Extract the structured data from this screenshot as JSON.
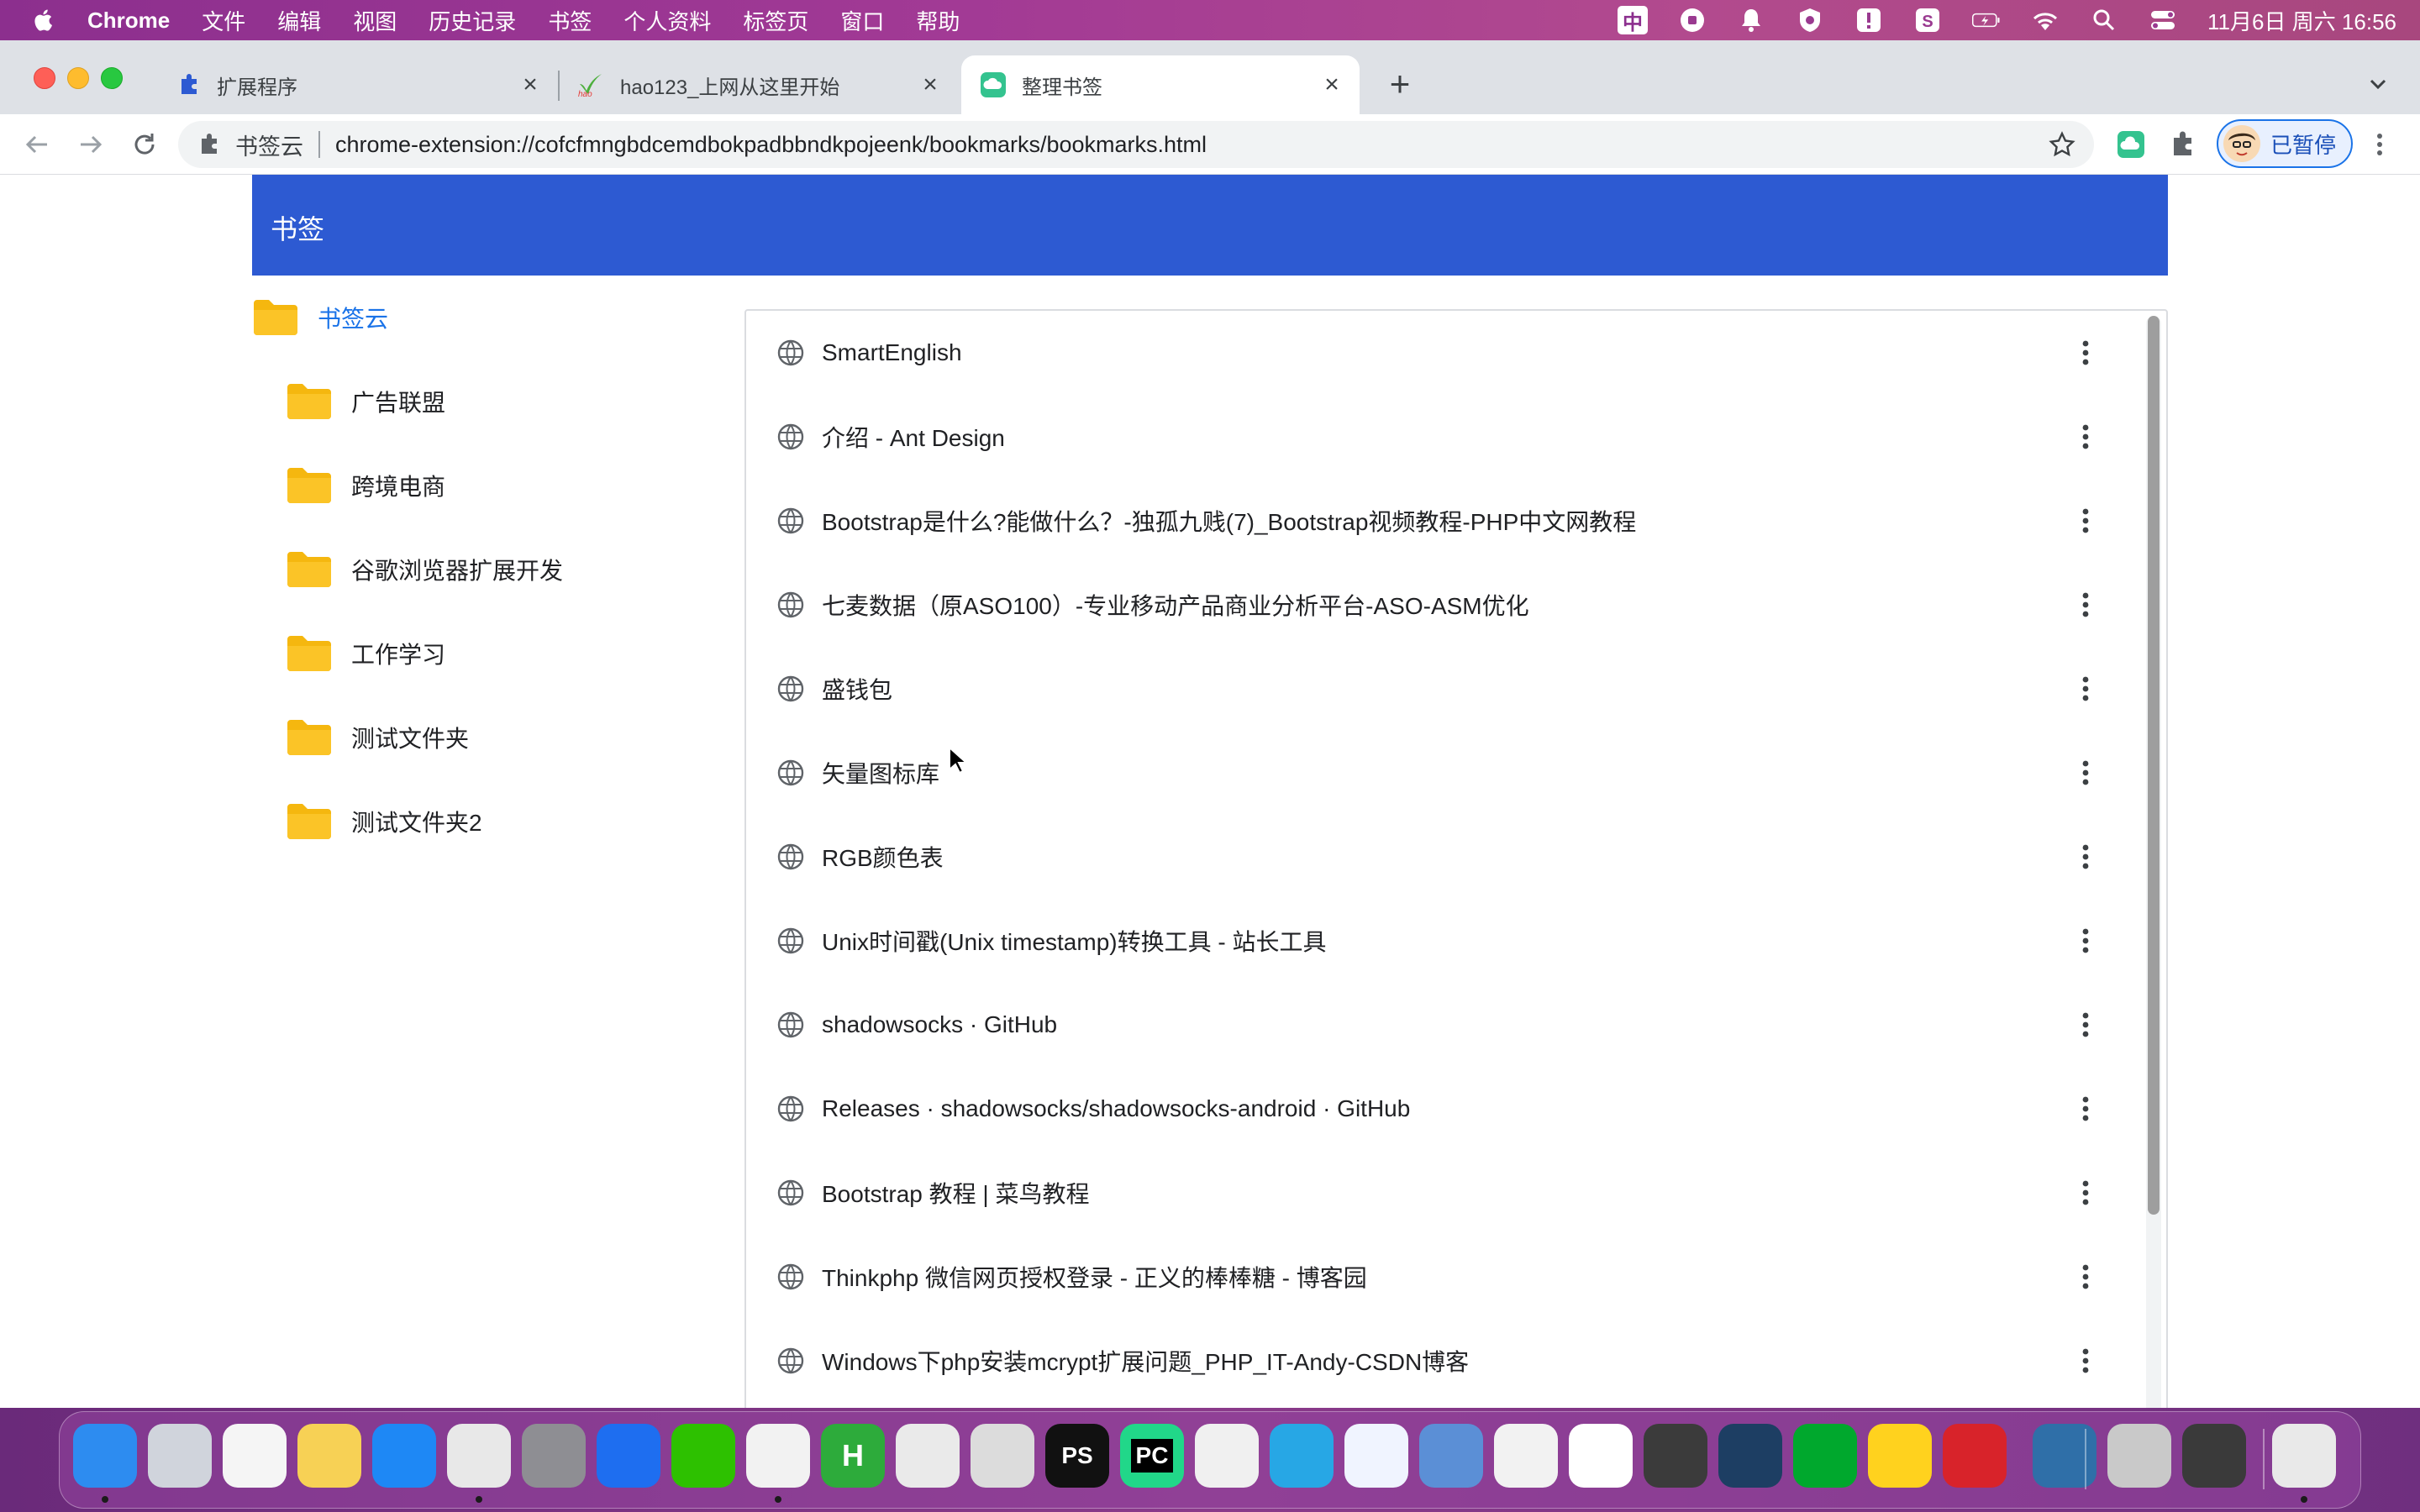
{
  "menubar": {
    "app_name": "Chrome",
    "items": [
      "文件",
      "编辑",
      "视图",
      "历史记录",
      "书签",
      "个人资料",
      "标签页",
      "窗口",
      "帮助"
    ],
    "ime_label": "中",
    "clock": "11月6日 周六  16:56"
  },
  "tabs": [
    {
      "title": "扩展程序",
      "icon": "puzzle-icon"
    },
    {
      "title": "hao123_上网从这里开始",
      "icon": "hao123-icon"
    },
    {
      "title": "整理书签",
      "icon": "bookmark-cloud-icon",
      "active": true
    }
  ],
  "toolbar": {
    "site_name": "书签云",
    "url": "chrome-extension://cofcfmngbdcemdbokpadbbndkpojeenk/bookmarks/bookmarks.html",
    "profile_label": "已暂停"
  },
  "page": {
    "header_title": "书签",
    "folders": [
      {
        "label": "书签云",
        "root": true
      },
      {
        "label": "广告联盟"
      },
      {
        "label": "跨境电商"
      },
      {
        "label": "谷歌浏览器扩展开发"
      },
      {
        "label": "工作学习"
      },
      {
        "label": "测试文件夹"
      },
      {
        "label": "测试文件夹2"
      }
    ],
    "bookmarks": [
      "SmartEnglish",
      "介绍 - Ant Design",
      "Bootstrap是什么?能做什么？-独孤九贱(7)_Bootstrap视频教程-PHP中文网教程",
      "七麦数据（原ASO100）-专业移动产品商业分析平台-ASO-ASM优化",
      "盛钱包",
      "矢量图标库",
      "RGB颜色表",
      "Unix时间戳(Unix timestamp)转换工具 - 站长工具",
      "shadowsocks · GitHub",
      "Releases · shadowsocks/shadowsocks-android · GitHub",
      "Bootstrap 教程 | 菜鸟教程",
      "Thinkphp 微信网页授权登录 - 正义的棒棒糖 - 博客园",
      "Windows下php安装mcrypt扩展问题_PHP_IT-Andy-CSDN博客"
    ]
  },
  "dock": {
    "apps": [
      {
        "name": "finder-icon",
        "color": "#2d8cf0"
      },
      {
        "name": "launchpad-icon",
        "color": "#d0d4dc"
      },
      {
        "name": "reminders-icon",
        "color": "#f5f5f5"
      },
      {
        "name": "notes-icon",
        "color": "#f7d155"
      },
      {
        "name": "app-store-icon",
        "color": "#1e88f5"
      },
      {
        "name": "chrome-icon",
        "color": "#e8e8e8"
      },
      {
        "name": "system-preferences-icon",
        "color": "#8e8e93"
      },
      {
        "name": "maps-pin-icon",
        "color": "#1e6ef0"
      },
      {
        "name": "wechat-icon",
        "color": "#2dc100"
      },
      {
        "name": "qq-icon",
        "color": "#f2f2f2"
      },
      {
        "name": "hbuilder-icon",
        "color": "#2dab3b",
        "glyph": "H"
      },
      {
        "name": "typora-icon",
        "color": "#eaeaea"
      },
      {
        "name": "iterm-icon",
        "color": "#dcdcdc"
      },
      {
        "name": "phpstorm-icon",
        "color": "#111111",
        "glyph": "PS"
      },
      {
        "name": "pycharm-icon",
        "color": "#21d789",
        "glyph": "PC"
      },
      {
        "name": "vscode-icon",
        "color": "#f0f0f0"
      },
      {
        "name": "telegram-icon",
        "color": "#27a7e5"
      },
      {
        "name": "baidu-netdisk-icon",
        "color": "#f0f4ff"
      },
      {
        "name": "remote-desktop-icon",
        "color": "#5b8fd6"
      },
      {
        "name": "wps-icon",
        "color": "#f2f2f2"
      },
      {
        "name": "g-app-icon",
        "color": "#ffffff"
      },
      {
        "name": "sublime-icon",
        "color": "#3b3b3b"
      },
      {
        "name": "mysql-workbench-icon",
        "color": "#1d3e63"
      },
      {
        "name": "evernote-icon",
        "color": "#00a82d"
      },
      {
        "name": "qq-music-icon",
        "color": "#ffd21e"
      },
      {
        "name": "anydesk-icon",
        "color": "#d8232a"
      },
      {
        "name": "dolphin-icon",
        "color": "#2f6fa8"
      },
      {
        "name": "printer-icon",
        "color": "#c9c9c9"
      },
      {
        "name": "quicktime-icon",
        "color": "#3a3a3a"
      },
      {
        "name": "trash-icon",
        "color": "#e9e9e9"
      }
    ]
  }
}
